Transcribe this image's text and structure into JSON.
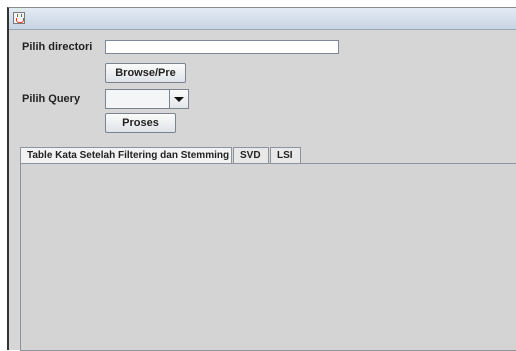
{
  "window": {
    "icon": "java-cup-icon"
  },
  "form": {
    "directory_label": "Pilih directori",
    "directory_value": "",
    "browse_label": "Browse/Pre",
    "query_label": "Pilih Query",
    "query_selected": "",
    "process_label": "Proses"
  },
  "tabs": [
    {
      "label": "Table Kata Setelah Filtering dan Stemming"
    },
    {
      "label": "SVD"
    },
    {
      "label": "LSI"
    }
  ]
}
